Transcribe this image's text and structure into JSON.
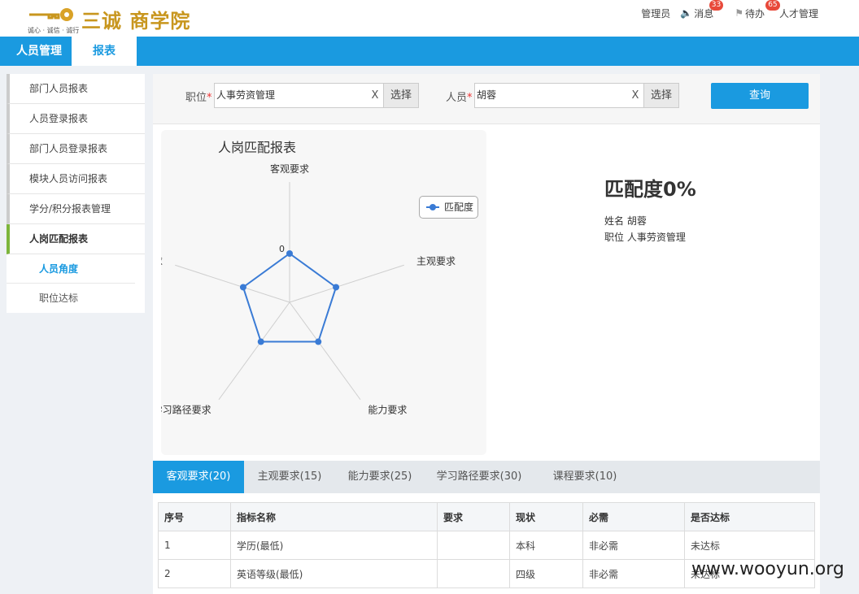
{
  "header": {
    "logo_text": "三诚 商学院",
    "logo_slogan": "诚心 · 诚信 · 诚行",
    "admin": "管理员",
    "messages": "消息",
    "messages_badge": "33",
    "todo": "待办",
    "todo_badge": "65",
    "talent": "人才管理"
  },
  "nav": {
    "hr": "人员管理",
    "report": "报表"
  },
  "sidebar": {
    "items": [
      "部门人员报表",
      "人员登录报表",
      "部门人员登录报表",
      "模块人员访问报表",
      "学分/积分报表管理",
      "人岗匹配报表"
    ],
    "subitems": [
      "人员角度",
      "职位达标"
    ]
  },
  "filter": {
    "position_label": "职位",
    "position_value": "人事劳资管理",
    "person_label": "人员",
    "person_value": "胡蓉",
    "required_mark": "*",
    "clear": "X",
    "pick": "选择",
    "query": "查询"
  },
  "chart_data": {
    "type": "radar",
    "title": "人岗匹配报表",
    "indicators": [
      "客观要求",
      "主观要求",
      "能力要求",
      "学习路径要求",
      "课程要求"
    ],
    "axis_tick": "0",
    "legend": [
      "匹配度"
    ],
    "series": [
      {
        "name": "匹配度",
        "values": [
          0,
          0,
          0,
          0,
          0
        ]
      }
    ],
    "color": "#3a7bd5"
  },
  "info": {
    "title": "匹配度0%",
    "name_line": "姓名 胡蓉",
    "position_line": "职位 人事劳资管理"
  },
  "tabs": [
    "客观要求(20)",
    "主观要求(15)",
    "能力要求(25)",
    "学习路径要求(30)",
    "课程要求(10)"
  ],
  "table": {
    "headers": [
      "序号",
      "指标名称",
      "要求",
      "现状",
      "必需",
      "是否达标"
    ],
    "rows": [
      [
        "1",
        "学历(最低)",
        "",
        "本科",
        "非必需",
        "未达标"
      ],
      [
        "2",
        "英语等级(最低)",
        "",
        "四级",
        "非必需",
        "未达标"
      ]
    ]
  },
  "watermark": "www.wooyun.org"
}
